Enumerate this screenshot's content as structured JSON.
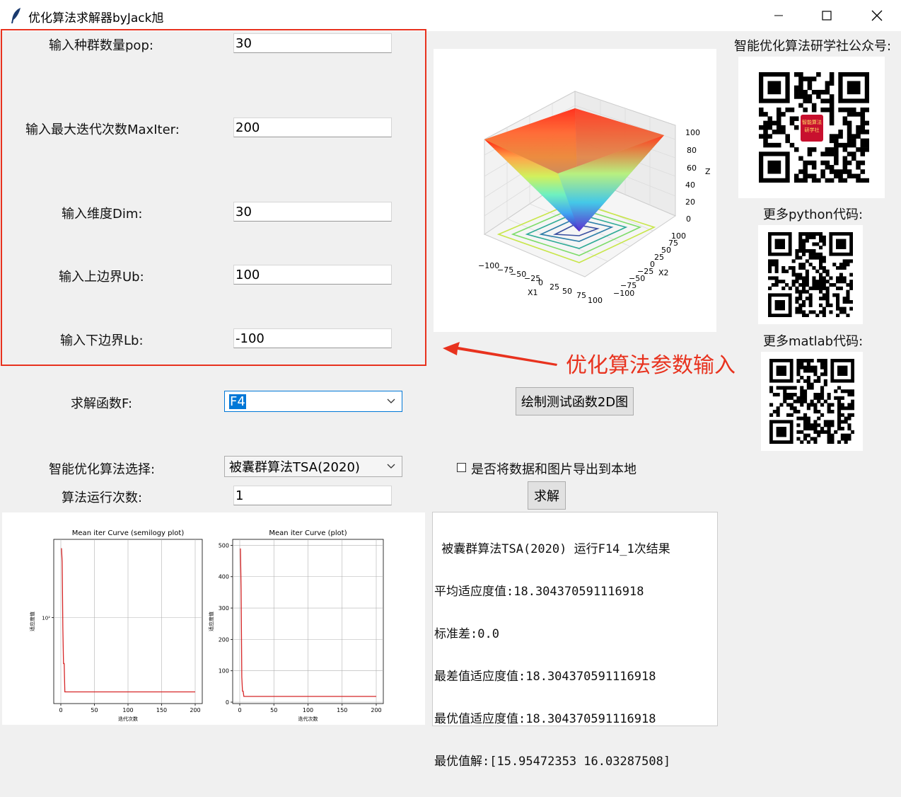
{
  "window": {
    "title": "优化算法求解器byJack旭",
    "minimize": "—",
    "maximize": "☐",
    "close": "✕"
  },
  "params": {
    "pop_label": "输入种群数量pop:",
    "pop_value": "30",
    "maxiter_label": "输入最大迭代次数MaxIter:",
    "maxiter_value": "200",
    "dim_label": "输入维度Dim:",
    "dim_value": "30",
    "ub_label": "输入上边界Ub:",
    "ub_value": "100",
    "lb_label": "输入下边界Lb:",
    "lb_value": "-100"
  },
  "annotation": "优化算法参数输入",
  "function": {
    "label": "求解函数F:",
    "selected": "F4",
    "plot_button": "绘制测试函数2D图"
  },
  "algorithm": {
    "label": "智能优化算法选择:",
    "selected": "被囊群算法TSA(2020)",
    "export_label": "是否将数据和图片导出到本地",
    "export_checked": false,
    "runs_label": "算法运行次数:",
    "runs_value": "1",
    "solve_button": "求解"
  },
  "sidebar": {
    "wechat_label": "智能优化算法研学社公众号:",
    "qr_center_text_1": "智能算法",
    "qr_center_text_2": "研学社",
    "python_label": "更多python代码:",
    "matlab_label": "更多matlab代码:"
  },
  "surface_plot": {
    "z_label": "Z",
    "x1_label": "X1",
    "x2_label": "X2",
    "z_ticks": [
      "100",
      "80",
      "60",
      "40",
      "20",
      "0"
    ],
    "x1_ticks": [
      "−100",
      "−75",
      "−50",
      "−25",
      "0",
      "25",
      "50",
      "75",
      "100"
    ],
    "x2_ticks": [
      "100",
      "75",
      "50",
      "25",
      "0",
      "−25",
      "−50",
      "−75",
      "−100"
    ]
  },
  "results": {
    "line1": " 被囊群算法TSA(2020) 运行F14_1次结果",
    "line2": "平均适应度值:18.304370591116918",
    "line3": "标准差:0.0",
    "line4": "最差值适应度值:18.304370591116918",
    "line5": "最优值适应度值:18.304370591116918",
    "line6": "最优值解:[15.95472353 16.03287508]"
  },
  "chart_data": [
    {
      "type": "line",
      "title": "Mean iter Curve (semilogy plot)",
      "xlabel": "迭代次数",
      "ylabel": "适应度值",
      "yscale": "log",
      "xlim": [
        0,
        200
      ],
      "x_ticks": [
        "0",
        "50",
        "100",
        "150",
        "200"
      ],
      "y_ticks": [
        "10²"
      ],
      "grid": true,
      "series": [
        {
          "color": "#d62728",
          "x": [
            1,
            2,
            3,
            4,
            5,
            6,
            8,
            10,
            50,
            100,
            150,
            200
          ],
          "y": [
            490,
            360,
            80,
            35,
            35,
            18.3,
            18.3,
            18.3,
            18.3,
            18.3,
            18.3,
            18.3
          ]
        }
      ]
    },
    {
      "type": "line",
      "title": "Mean iter Curve (plot)",
      "xlabel": "迭代次数",
      "ylabel": "适应度值",
      "xlim": [
        0,
        200
      ],
      "ylim": [
        0,
        510
      ],
      "x_ticks": [
        "0",
        "50",
        "100",
        "150",
        "200"
      ],
      "y_ticks": [
        "0",
        "100",
        "200",
        "300",
        "400",
        "500"
      ],
      "grid": true,
      "series": [
        {
          "color": "#d62728",
          "x": [
            1,
            2,
            3,
            4,
            5,
            6,
            8,
            10,
            50,
            100,
            150,
            200
          ],
          "y": [
            490,
            360,
            80,
            35,
            35,
            18.3,
            18.3,
            18.3,
            18.3,
            18.3,
            18.3,
            18.3
          ]
        }
      ]
    }
  ]
}
